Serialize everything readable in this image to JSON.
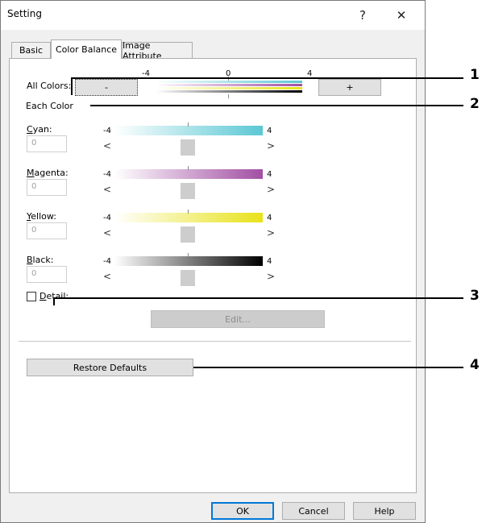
{
  "window": {
    "title": "Setting",
    "help_glyph": "?",
    "close_glyph": "✕"
  },
  "tabs": [
    {
      "label": "Basic"
    },
    {
      "label": "Color Balance"
    },
    {
      "label": "Image Attribute"
    }
  ],
  "all_colors": {
    "label": "All Colors:",
    "minus_label": "-",
    "plus_label": "+",
    "scale": {
      "min": "-4",
      "mid": "0",
      "max": "4"
    }
  },
  "each_color": {
    "label": "Each Color",
    "channels": [
      {
        "label": "Cyan:",
        "value": "0",
        "min": "-4",
        "max": "4",
        "color": "#5bc8d4",
        "level": 0
      },
      {
        "label": "Magenta:",
        "value": "0",
        "min": "-4",
        "max": "4",
        "color": "#a24fa3",
        "level": 0
      },
      {
        "label": "Yellow:",
        "value": "0",
        "min": "-4",
        "max": "4",
        "color": "#e8e21a",
        "level": 0
      },
      {
        "label": "Black:",
        "value": "0",
        "min": "-4",
        "max": "4",
        "color": "#000000",
        "level": 0
      }
    ],
    "left_arrow": "<",
    "right_arrow": ">"
  },
  "detail": {
    "label": "Detail:",
    "checked": false,
    "edit_label": "Edit..."
  },
  "restore_defaults_label": "Restore Defaults",
  "footer": {
    "ok_label": "OK",
    "cancel_label": "Cancel",
    "help_label": "Help"
  },
  "callouts": [
    "1",
    "2",
    "3",
    "4"
  ]
}
